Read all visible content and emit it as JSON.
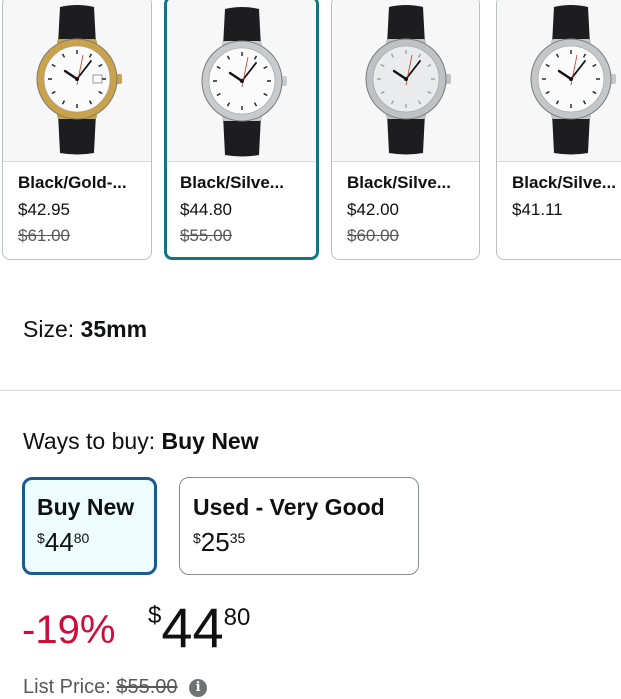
{
  "variants": [
    {
      "name": "Black/Gold-...",
      "price": "$42.95",
      "list_price": "$61.00",
      "case_color": "#c9a24a",
      "dial": "date",
      "selected": false
    },
    {
      "name": "Black/Silve...",
      "price": "$44.80",
      "list_price": "$55.00",
      "case_color": "#c8cbce",
      "dial": "plain",
      "selected": true
    },
    {
      "name": "Black/Silve...",
      "price": "$42.00",
      "list_price": "$60.00",
      "case_color": "#bfc2c4",
      "dial": "light",
      "selected": false
    },
    {
      "name": "Black/Silve...",
      "price": "$41.11",
      "list_price": "",
      "case_color": "#c4c7c9",
      "dial": "small",
      "selected": false
    }
  ],
  "size": {
    "label": "Size:",
    "value": "35mm"
  },
  "ways_to_buy": {
    "label": "Ways to buy:",
    "selected": "Buy New",
    "options": [
      {
        "label": "Buy New",
        "price_currency": "$",
        "price_whole": "44",
        "price_fraction": "80",
        "selected": true
      },
      {
        "label": "Used - Very Good",
        "price_currency": "$",
        "price_whole": "25",
        "price_fraction": "35",
        "selected": false
      }
    ]
  },
  "price_block": {
    "discount": "-19%",
    "currency": "$",
    "whole": "44",
    "fraction": "80",
    "list_label": "List Price:",
    "list_value": "$55.00",
    "info_icon": "info-icon"
  },
  "colors": {
    "selected_variant_border": "#127580",
    "selected_option_border": "#1b5a8e",
    "discount": "#cc0c39"
  }
}
